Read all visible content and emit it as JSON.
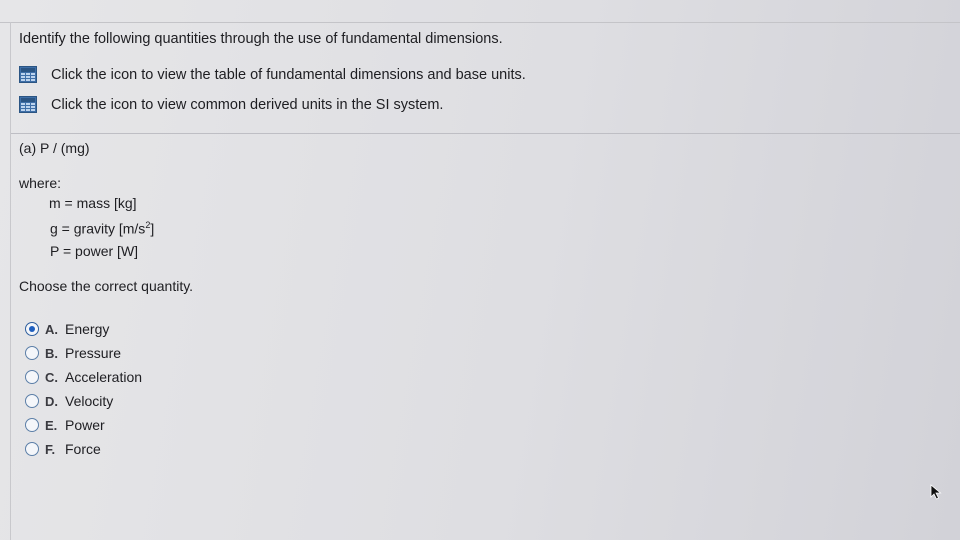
{
  "intro": {
    "title": "Identify the following quantities through the use of fundamental dimensions."
  },
  "links": [
    {
      "label": "Click the icon to view the table of fundamental dimensions and base units.",
      "icon": "table-icon"
    },
    {
      "label": "Click the icon to view common derived units in the SI system.",
      "icon": "table-icon"
    }
  ],
  "question": {
    "part_label": "(a)  P / (mg)",
    "where_label": "where:",
    "definitions": {
      "m": "m = mass [kg]",
      "g_prefix": "g = gravity [m/s",
      "g_exp": "2",
      "g_suffix": "]",
      "p": "P = power [W]"
    },
    "prompt": "Choose the correct quantity."
  },
  "options": [
    {
      "letter": "A.",
      "label": "Energy",
      "selected": true
    },
    {
      "letter": "B.",
      "label": "Pressure",
      "selected": false
    },
    {
      "letter": "C.",
      "label": "Acceleration",
      "selected": false
    },
    {
      "letter": "D.",
      "label": "Velocity",
      "selected": false
    },
    {
      "letter": "E.",
      "label": "Power",
      "selected": false
    },
    {
      "letter": "F.",
      "label": "Force",
      "selected": false
    }
  ],
  "colors": {
    "accent": "#1f5fbf",
    "icon": "#3f6fa8"
  }
}
